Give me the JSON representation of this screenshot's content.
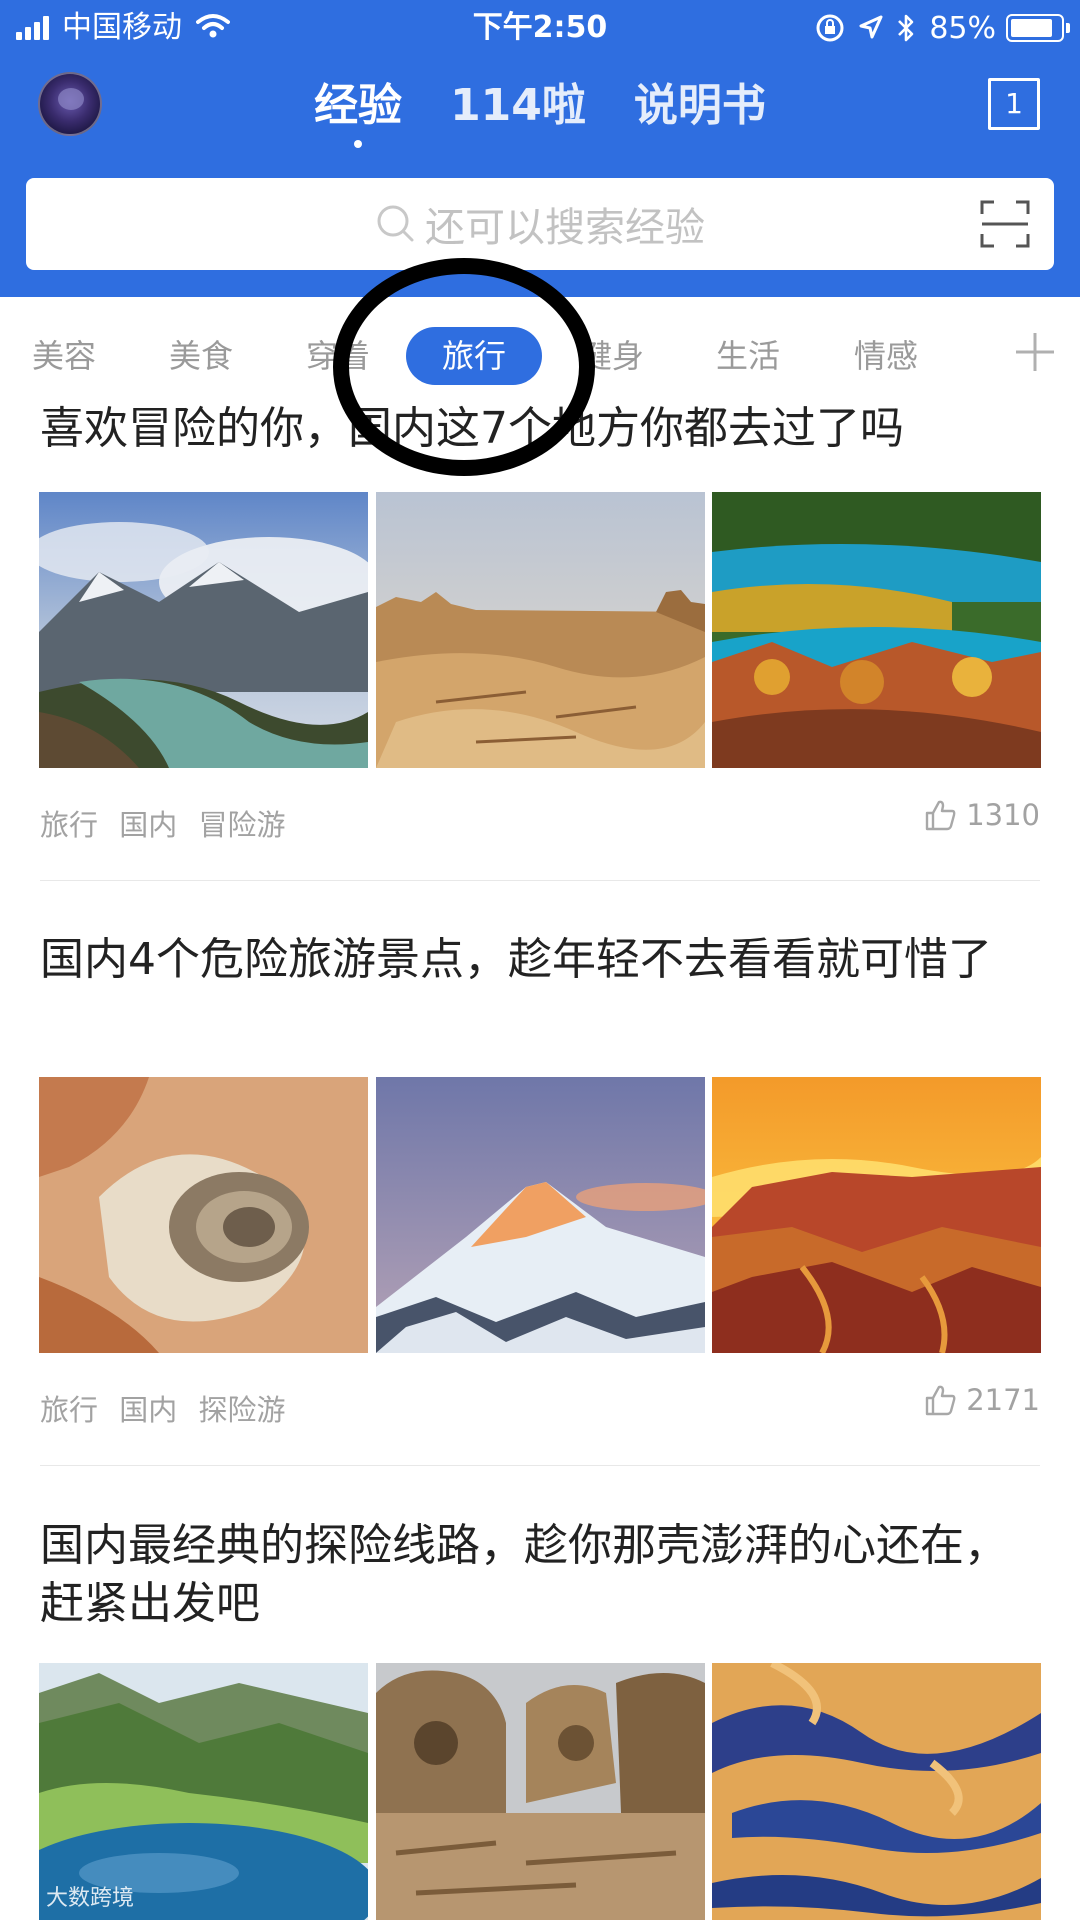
{
  "status_bar": {
    "carrier": "中国移动",
    "time": "下午2:50",
    "battery": "85%",
    "battery_level": 0.85
  },
  "header": {
    "tabs": [
      {
        "label": "经验",
        "active": true
      },
      {
        "label": "114啦",
        "active": false
      },
      {
        "label": "说明书",
        "active": false
      }
    ],
    "message_count": "1"
  },
  "search": {
    "placeholder": "还可以搜索经验"
  },
  "categories": [
    {
      "label": "美容",
      "active": false
    },
    {
      "label": "美食",
      "active": false
    },
    {
      "label": "穿着",
      "active": false
    },
    {
      "label": "旅行",
      "active": true
    },
    {
      "label": "健身",
      "active": false
    },
    {
      "label": "生活",
      "active": false
    },
    {
      "label": "情感",
      "active": false
    }
  ],
  "articles": [
    {
      "title": "喜欢冒险的你，国内这7个地方你都去过了吗",
      "tags": [
        "旅行",
        "国内",
        "冒险游"
      ],
      "likes": "1310"
    },
    {
      "title": "国内4个危险旅游景点，趁年轻不去看看就可惜了",
      "tags": [
        "旅行",
        "国内",
        "探险游"
      ],
      "likes": "2171"
    },
    {
      "title": "国内最经典的探险线路，趁你那壳澎湃的心还在，赶紧出发吧",
      "tags": [],
      "likes": ""
    }
  ],
  "watermark": "大数跨境",
  "colors": {
    "primary": "#2f6ee0",
    "muted_text": "#a2a2a2",
    "title_text": "#222222"
  }
}
